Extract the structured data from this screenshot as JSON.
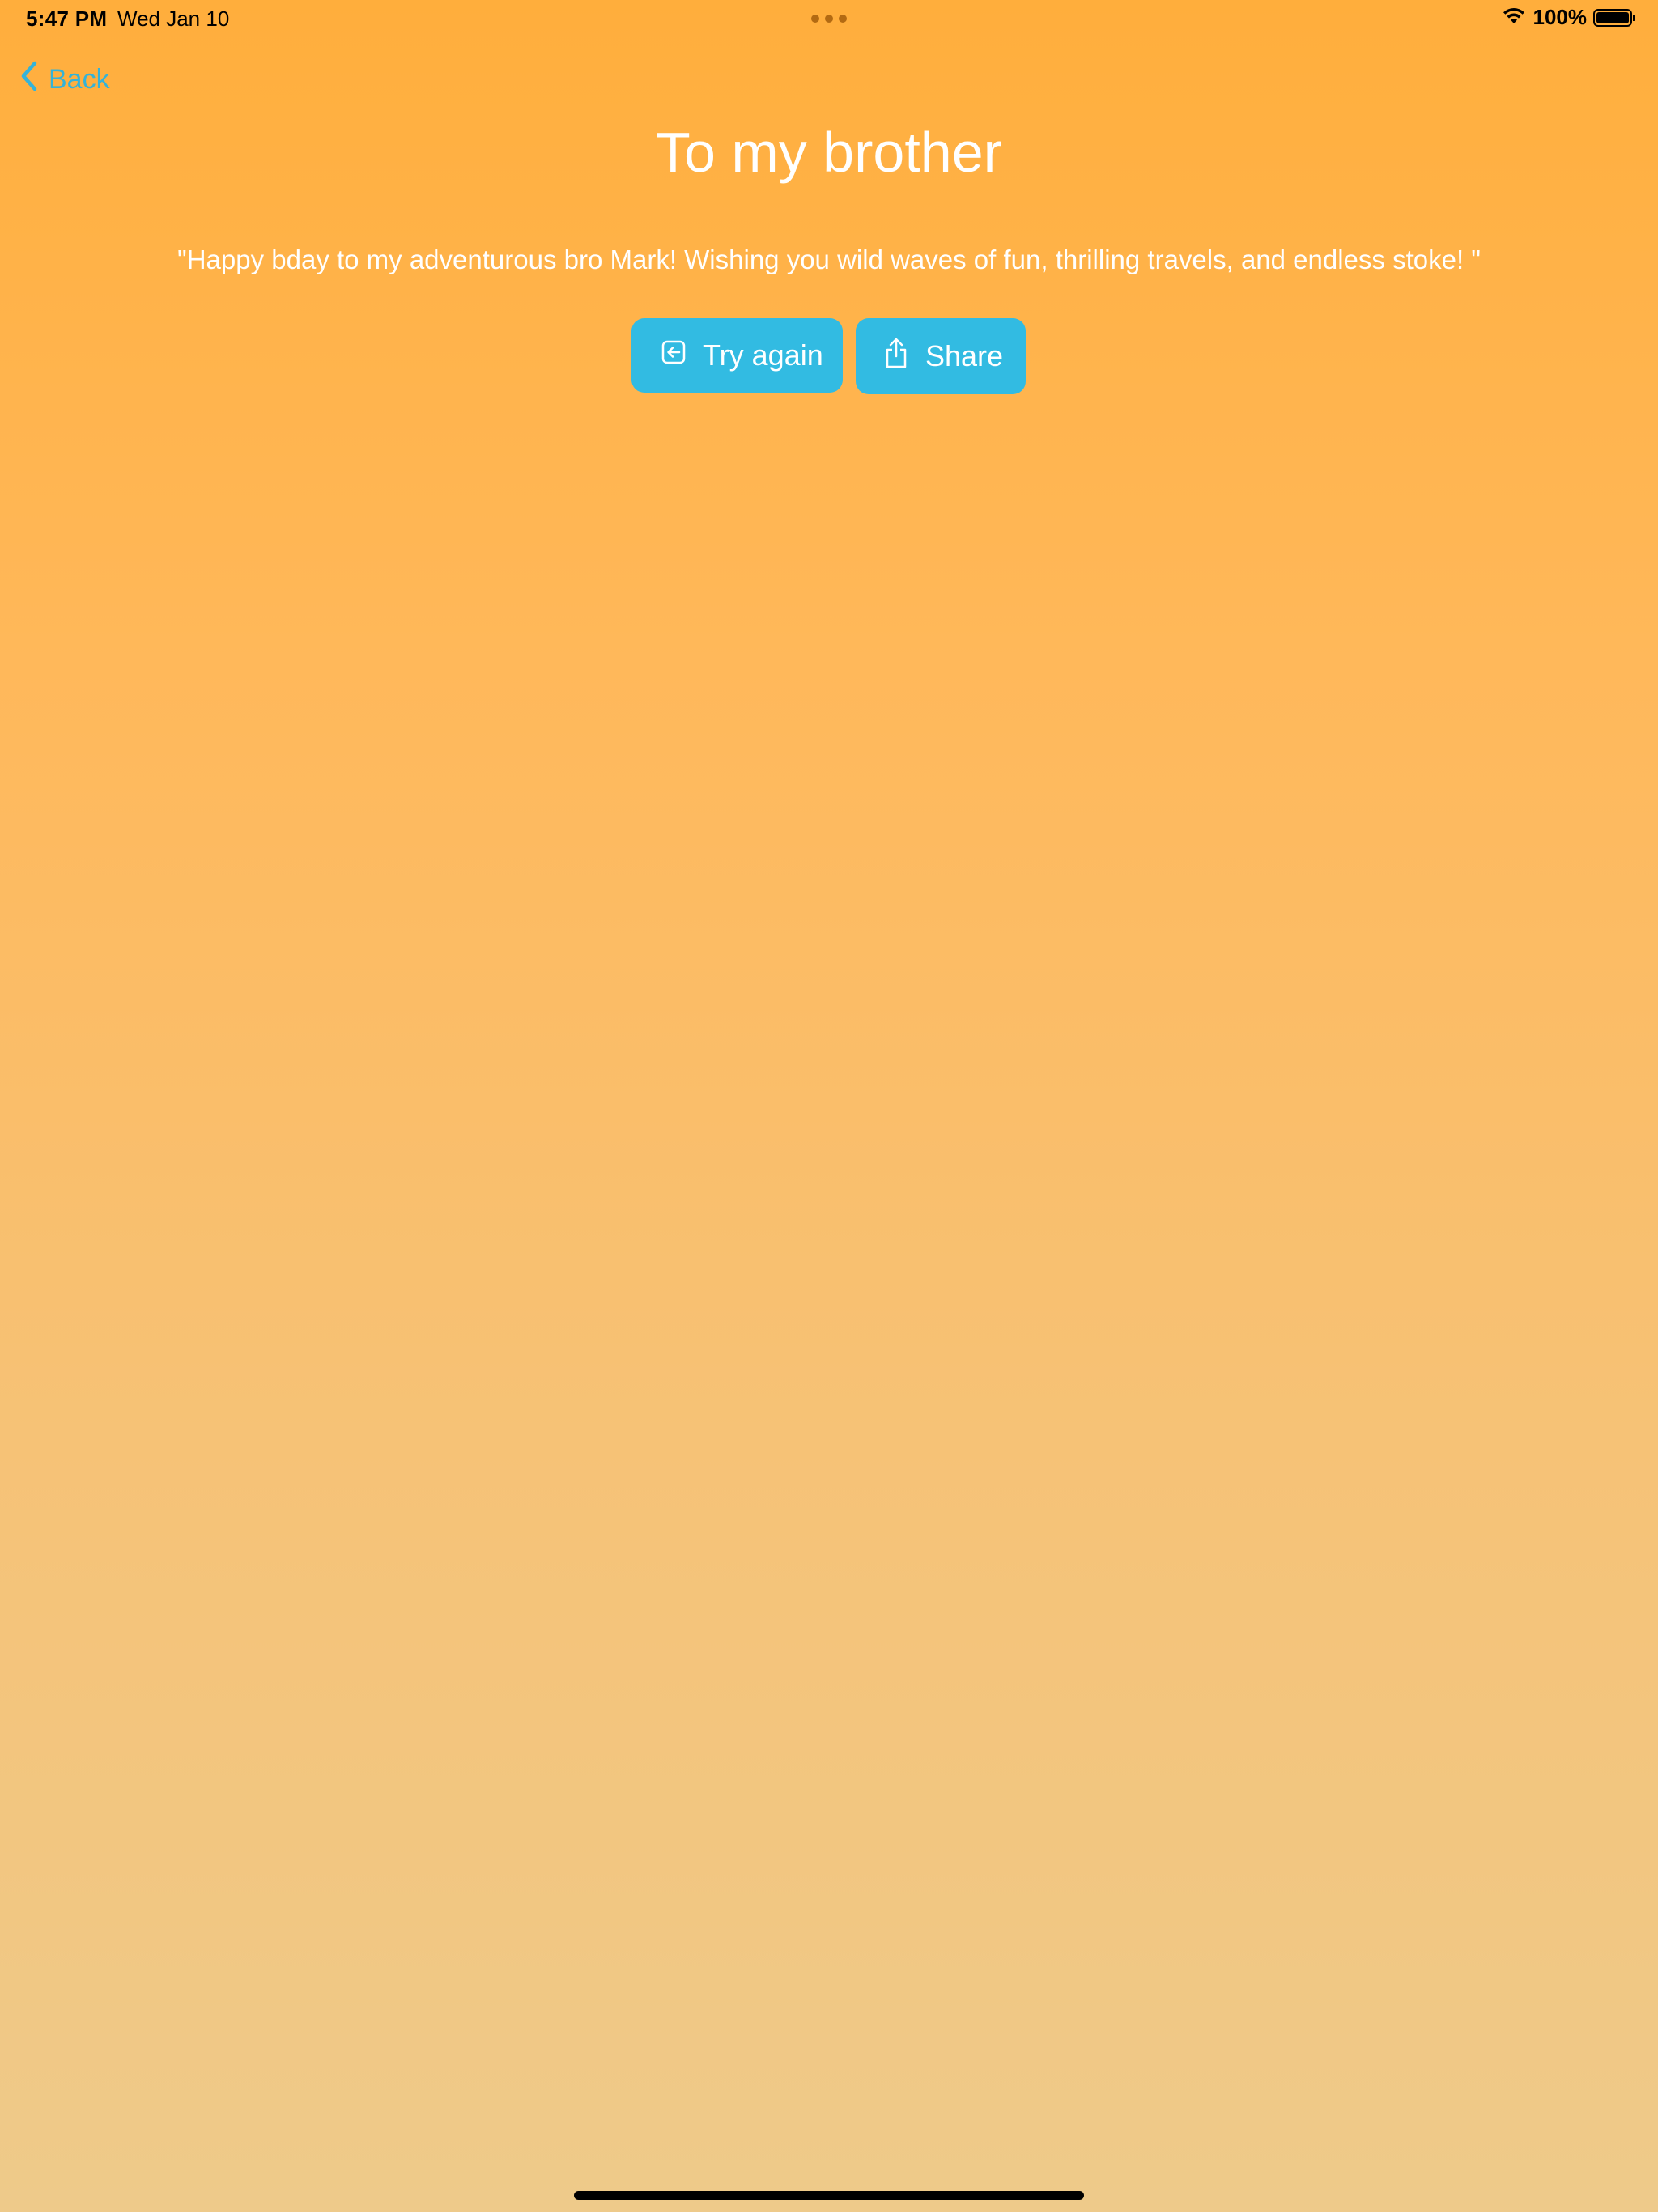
{
  "status_bar": {
    "time": "5:47 PM",
    "date": "Wed Jan 10",
    "battery": "100%",
    "icons": [
      "wifi-icon",
      "battery-icon"
    ]
  },
  "nav": {
    "back_label": "Back",
    "back_icon": "chevron-left-icon"
  },
  "page": {
    "title": "To my brother",
    "message": "\"Happy bday to my adventurous bro Mark! Wishing you wild waves of fun, thrilling travels, and endless stoke! \""
  },
  "actions": {
    "try_again_label": "Try again",
    "try_again_icon": "arrow-left-square-icon",
    "share_label": "Share",
    "share_icon": "share-icon"
  },
  "colors": {
    "accent": "#32BBE2",
    "back_link": "#35B3D8",
    "background_top": "#FFAE3C",
    "background_bottom": "#EECA8A",
    "text": "#FFFFFF"
  }
}
